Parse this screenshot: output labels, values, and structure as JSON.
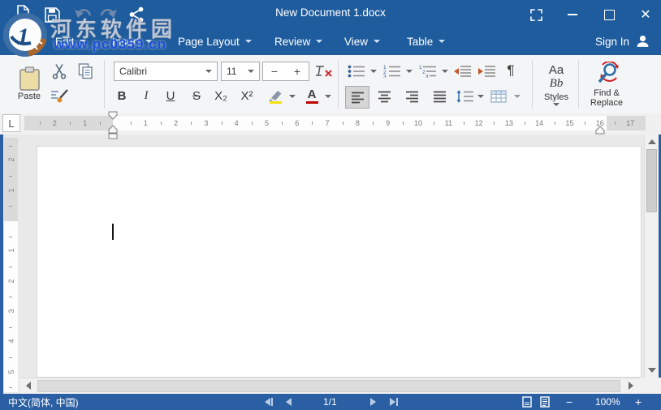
{
  "titlebar": {
    "title": "New Document 1.docx",
    "close_glyph": "✕",
    "quick_actions": [
      "new-document",
      "save",
      "undo",
      "redo",
      "share"
    ]
  },
  "menu": {
    "items": [
      {
        "label": "Edit"
      },
      {
        "label": "Insert"
      },
      {
        "label": "Page Layout"
      },
      {
        "label": "Review"
      },
      {
        "label": "View"
      },
      {
        "label": "Table"
      }
    ],
    "sign_in_label": "Sign In"
  },
  "toolbar": {
    "paste_label": "Paste",
    "font_name": "Calibri",
    "font_size": "11",
    "decrease_font": "−",
    "increase_font": "+",
    "bold": "B",
    "italic": "I",
    "underline": "U",
    "strikethrough": "S",
    "subscript": "X₂",
    "superscript": "X²",
    "font_color_letter": "A",
    "pilcrow": "¶",
    "styles": {
      "preview_line1": "Aa",
      "preview_line2": "Bb",
      "label": "Styles"
    },
    "find_replace": {
      "line1": "Find &",
      "line2": "Replace"
    }
  },
  "ruler": {
    "tab_selector": "L",
    "h_margin_numbers": [
      "2",
      "1"
    ],
    "h_numbers": [
      "1",
      "2",
      "3",
      "4",
      "5",
      "6",
      "7",
      "8",
      "9",
      "10",
      "11",
      "12",
      "13",
      "14",
      "15",
      "16",
      "17"
    ],
    "v_margin_numbers": [
      "2",
      "1"
    ],
    "v_numbers": [
      "1",
      "2",
      "3",
      "4",
      "5"
    ]
  },
  "statusbar": {
    "language": "中文(简体, 中国)",
    "page_indicator": "1/1",
    "zoom_out": "−",
    "zoom_level": "100%",
    "zoom_in": "+"
  },
  "watermark": {
    "site_name": "河东软件园",
    "site_url": "www.pc0359.cn"
  },
  "colors": {
    "titlebar_blue": "#1e5c9e",
    "statusbar_blue": "#2b5fa3",
    "highlight_yellow": "#f3e114",
    "font_color_red": "#c00000",
    "list_accent_blue": "#3a5f9f",
    "indent_arrow_orange": "#c3572c"
  }
}
